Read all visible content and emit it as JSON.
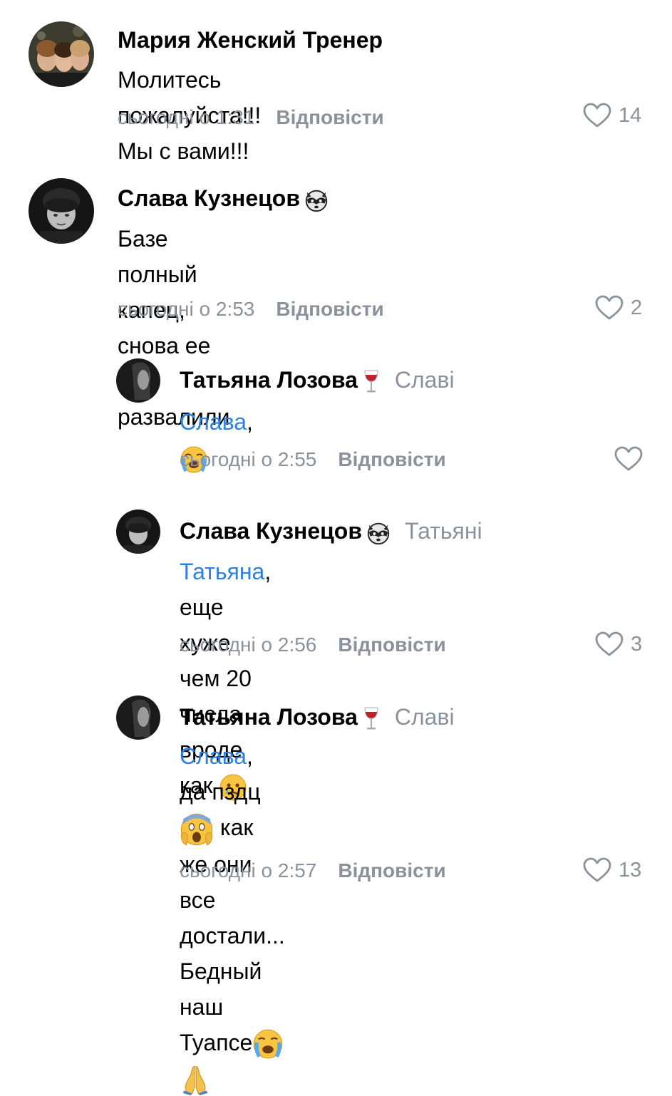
{
  "comments": [
    {
      "author": "Мария Женский Тренер",
      "text": "Молитесь пожалуйста!!! Мы с вами!!!",
      "time": "сьогодні о 1:31",
      "reply_label": "Відповісти",
      "likes": "14"
    },
    {
      "author": "Слава Кузнецов",
      "badge_icon": "raccoon-emoji-icon",
      "text_line1": "Базе полный капец, снова ее всю",
      "text_line2": "развалили",
      "time": "сьогодні о 2:53",
      "reply_label": "Відповісти",
      "likes": "2"
    },
    {
      "author": "Татьяна Лозова",
      "badge_icon": "wine-glass-icon",
      "reply_to": "Славі",
      "mention": "Слава",
      "text_after_mention": ",",
      "emoji": "loudly-crying-face-icon",
      "time": "сьогодні о 2:55",
      "reply_label": "Відповісти",
      "likes": ""
    },
    {
      "author": "Слава Кузнецов",
      "badge_icon": "raccoon-emoji-icon",
      "reply_to": "Татьяні",
      "mention": "Татьяна",
      "text_line1_after_mention": ", еще хуже чем 20 числа",
      "text_line2": "вроде как",
      "emoji": "crying-face-icon",
      "time": "сьогодні о 2:56",
      "reply_label": "Відповісти",
      "likes": "3"
    },
    {
      "author": "Татьяна Лозова",
      "badge_icon": "wine-glass-icon",
      "reply_to": "Славі",
      "mention": "Слава",
      "text_line1_a": ", да пздц",
      "text_line1_b": " как же они все",
      "text_line2": "достали... Бедный наш Туапсе",
      "emojis": [
        "screaming-face-icon",
        "loudly-crying-face-icon",
        "folded-hands-icon"
      ],
      "time": "сьогодні о 2:57",
      "reply_label": "Відповісти",
      "likes": "13"
    }
  ],
  "colors": {
    "secondary_text": "#8a929b",
    "mention": "#2d81e0",
    "text": "#000000",
    "background": "#ffffff"
  }
}
